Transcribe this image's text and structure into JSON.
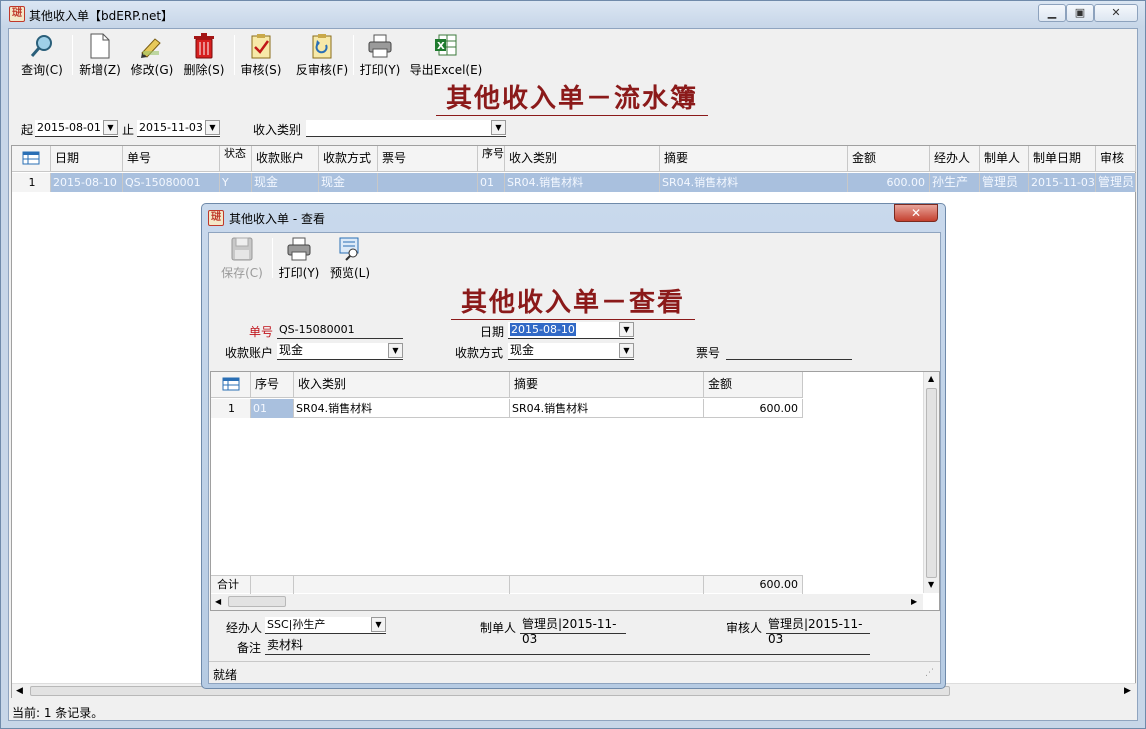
{
  "window": {
    "title": "其他收入单【bdERP.net】"
  },
  "toolbar": [
    {
      "label": "查询(C)",
      "icon": "search-icon"
    },
    {
      "label": "新增(Z)",
      "icon": "new-document-icon"
    },
    {
      "label": "修改(G)",
      "icon": "edit-icon"
    },
    {
      "label": "删除(S)",
      "icon": "trash-icon"
    },
    {
      "label": "审核(S)",
      "icon": "approve-icon"
    },
    {
      "label": "反审核(F)",
      "icon": "unapprove-icon"
    },
    {
      "label": "打印(Y)",
      "icon": "printer-icon"
    },
    {
      "label": "导出Excel(E)",
      "icon": "excel-icon"
    }
  ],
  "main": {
    "title": "其他收入单－流水簿",
    "filter": {
      "from_label": "起",
      "from_value": "2015-08-01",
      "to_label": "止",
      "to_value": "2015-11-03",
      "category_label": "收入类别",
      "category_value": ""
    },
    "columns": [
      "日期",
      "单号",
      "状态",
      "收款账户",
      "收款方式",
      "票号",
      "序号",
      "收入类别",
      "摘要",
      "金额",
      "经办人",
      "制单人",
      "制单日期",
      "审核人"
    ],
    "rows": [
      {
        "num": "1",
        "date": "2015-08-10",
        "no": "QS-15080001",
        "status": "Y",
        "account": "现金",
        "method": "现金",
        "ticket": "",
        "seq": "01",
        "category": "SR04.销售材料",
        "summary": "SR04.销售材料",
        "amount": "600.00",
        "handler": "孙生产",
        "maker": "管理员",
        "make_date": "2015-11-03",
        "auditor": "管理员"
      }
    ]
  },
  "status": {
    "text": "当前: 1 条记录。"
  },
  "dialog": {
    "title": "其他收入单 - 查看",
    "toolbar": [
      {
        "label": "保存(C)",
        "icon": "save-icon",
        "disabled": true
      },
      {
        "label": "打印(Y)",
        "icon": "printer-icon",
        "disabled": false
      },
      {
        "label": "预览(L)",
        "icon": "preview-icon",
        "disabled": false
      }
    ],
    "heading": "其他收入单－查看",
    "fields": {
      "no_label": "单号",
      "no_value": "QS-15080001",
      "date_label": "日期",
      "date_value": "2015-08-10",
      "account_label": "收款账户",
      "account_value": "现金",
      "method_label": "收款方式",
      "method_value": "现金",
      "ticket_label": "票号",
      "ticket_value": ""
    },
    "grid": {
      "columns": [
        "序号",
        "收入类别",
        "摘要",
        "金额"
      ],
      "rows": [
        {
          "num": "1",
          "seq": "01",
          "category": "SR04.销售材料",
          "summary": "SR04.销售材料",
          "amount": "600.00"
        }
      ],
      "total_label": "合计",
      "total_amount": "600.00"
    },
    "footer": {
      "handler_label": "经办人",
      "handler_value": "SSC|孙生产",
      "maker_label": "制单人",
      "maker_value": "管理员|2015-11-03",
      "auditor_label": "审核人",
      "auditor_value": "管理员|2015-11-03",
      "note_label": "备注",
      "note_value": "卖材料"
    },
    "status": "就绪"
  }
}
